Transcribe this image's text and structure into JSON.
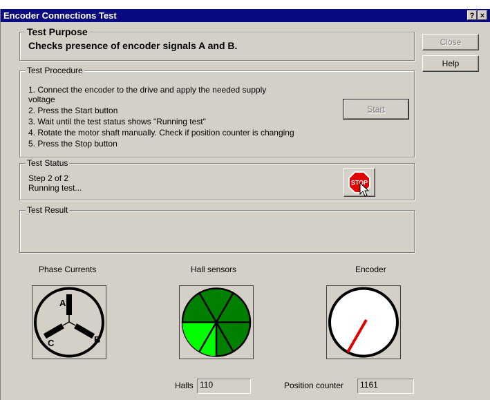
{
  "window": {
    "title": "Encoder Connections Test",
    "help_glyph": "?",
    "close_glyph": "×"
  },
  "buttons": {
    "close": "Close",
    "help": "Help",
    "start": "Start",
    "stop": "STOP"
  },
  "purpose": {
    "label": "Test Purpose",
    "text": "Checks presence of encoder signals A and B."
  },
  "procedure": {
    "label": "Test Procedure",
    "steps": [
      "1. Connect the encoder to the drive and apply the needed supply",
      "voltage",
      "2. Press the Start button",
      "3. Wait until the test status shows \"Running test\"",
      "4. Rotate the motor shaft manually. Check if position counter is changing",
      "5. Press the Stop button"
    ]
  },
  "status": {
    "label": "Test Status",
    "line1": "Step 2 of 2",
    "line2": "Running test..."
  },
  "result": {
    "label": "Test Result"
  },
  "phase": {
    "label": "Phase Currents",
    "a": "A",
    "b": "B",
    "c": "C"
  },
  "hall": {
    "label": "Hall sensors",
    "field_label": "Halls",
    "value": "110"
  },
  "encoder": {
    "label": "Encoder",
    "field_label": "Position counter",
    "value": "1161"
  },
  "colors": {
    "title_bar": "#0a0a80",
    "face": "#d4d0c8",
    "hall_dark": "#008000",
    "hall_lit": "#00ff00",
    "needle": "#e00000",
    "stop_red": "#e00000"
  }
}
